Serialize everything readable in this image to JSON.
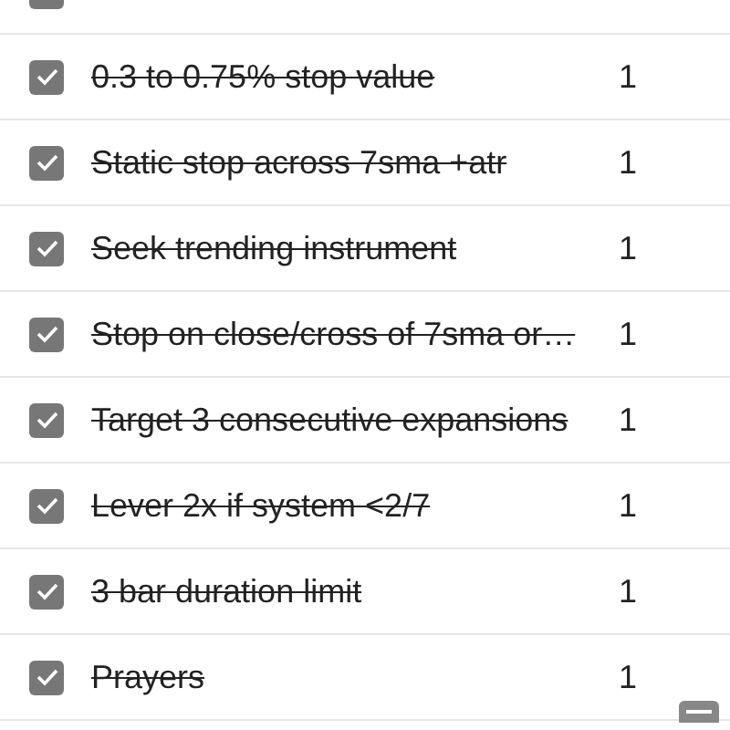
{
  "items": [
    {
      "checked": true
    },
    {
      "label": "0.3 to 0.75% stop value",
      "count": "1",
      "checked": true
    },
    {
      "label": "Static stop across 7sma +atr",
      "count": "1",
      "checked": true
    },
    {
      "label": "Seek trending instrument",
      "count": "1",
      "checked": true
    },
    {
      "label": "Stop on close/cross of 7sma or…",
      "count": "1",
      "checked": true
    },
    {
      "label": "Target 3 consecutive expansions",
      "count": "1",
      "checked": true
    },
    {
      "label": "Lever 2x if system <2/7",
      "count": "1",
      "checked": true
    },
    {
      "label": "3 bar duration limit",
      "count": "1",
      "checked": true
    },
    {
      "label": "Prayers",
      "count": "1",
      "checked": true
    }
  ]
}
